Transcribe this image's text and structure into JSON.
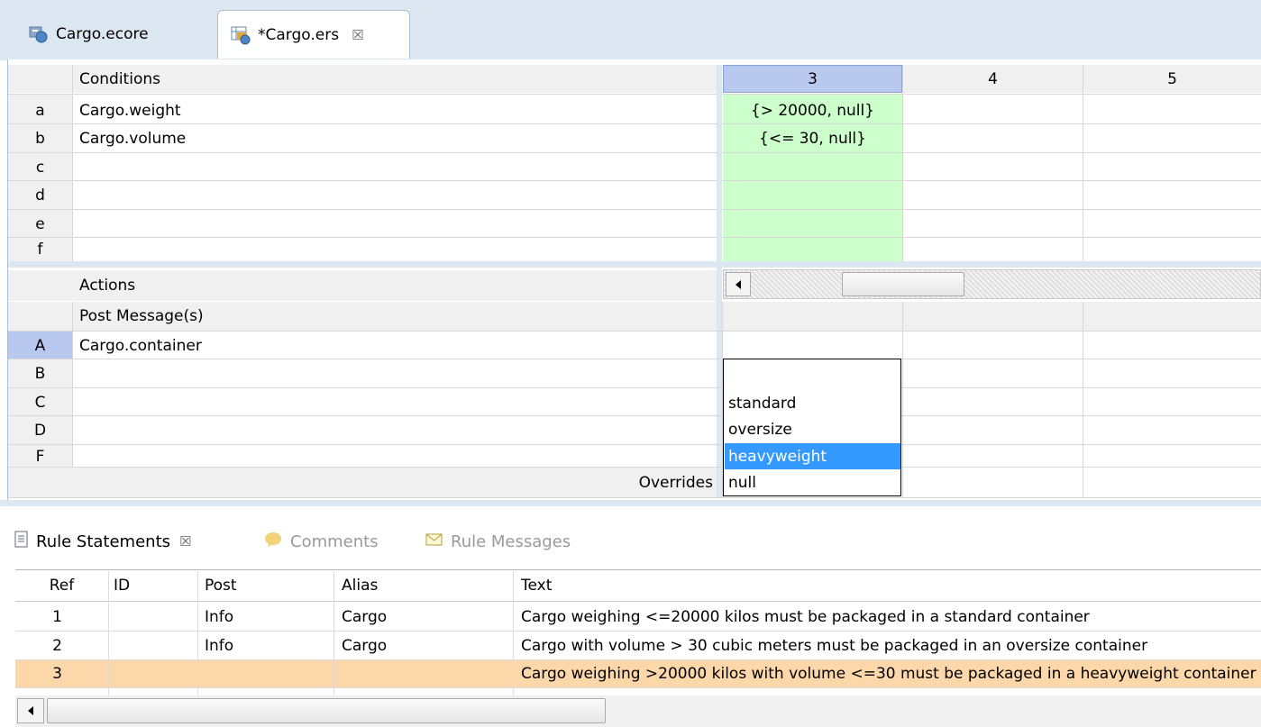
{
  "editor_tabs": [
    {
      "label": "Cargo.ecore",
      "icon": "ecore-model-icon",
      "active": false
    },
    {
      "label": "*Cargo.ers",
      "icon": "ruleflow-editor-icon",
      "active": true,
      "close_icon": "☒"
    }
  ],
  "conditions": {
    "title": "Conditions",
    "rows": [
      {
        "id": "a",
        "expr": "Cargo.weight",
        "rule3": "{> 20000, null}"
      },
      {
        "id": "b",
        "expr": "Cargo.volume",
        "rule3": "{<= 30, null}"
      },
      {
        "id": "c",
        "expr": "",
        "rule3": ""
      },
      {
        "id": "d",
        "expr": "",
        "rule3": ""
      },
      {
        "id": "e",
        "expr": "",
        "rule3": ""
      },
      {
        "id": "f",
        "expr": "",
        "rule3": ""
      }
    ]
  },
  "rule_columns": [
    "3",
    "4",
    "5"
  ],
  "actions": {
    "title": "Actions",
    "post_messages_label": "Post Message(s)",
    "rows": [
      {
        "id": "A",
        "expr": "Cargo.container"
      },
      {
        "id": "B",
        "expr": ""
      },
      {
        "id": "C",
        "expr": ""
      },
      {
        "id": "D",
        "expr": ""
      },
      {
        "id": "F",
        "expr": ""
      }
    ],
    "overrides_label": "Overrides"
  },
  "dropdown": {
    "options": [
      "standard",
      "oversize",
      "heavyweight",
      "null"
    ],
    "selected": "heavyweight"
  },
  "bottom_tabs": [
    {
      "label": "Rule Statements",
      "icon": "document-icon",
      "active": true,
      "close_icon": "☒"
    },
    {
      "label": "Comments",
      "icon": "comment-bubble-icon",
      "active": false
    },
    {
      "label": "Rule Messages",
      "icon": "envelope-icon",
      "active": false
    }
  ],
  "rule_statements": {
    "columns": [
      "Ref",
      "ID",
      "Post",
      "Alias",
      "Text"
    ],
    "rows": [
      {
        "ref": "1",
        "id": "",
        "post": "Info",
        "alias": "Cargo",
        "text": "Cargo weighing <=20000 kilos must be packaged in a standard container"
      },
      {
        "ref": "2",
        "id": "",
        "post": "Info",
        "alias": "Cargo",
        "text": "Cargo with volume > 30 cubic meters must be packaged in an oversize container"
      },
      {
        "ref": "3",
        "id": "",
        "post": "",
        "alias": "",
        "text": "Cargo weighing >20000 kilos with volume <=30 must be packaged in a heavyweight container"
      }
    ],
    "selected_ref": "3"
  },
  "colors": {
    "green_cell": "#ccffcc",
    "selected_col_header": "#b8c8ee",
    "dropdown_highlight": "#3399ff",
    "selected_row": "#fcd7aa",
    "tab_strip": "#dde7f2"
  }
}
